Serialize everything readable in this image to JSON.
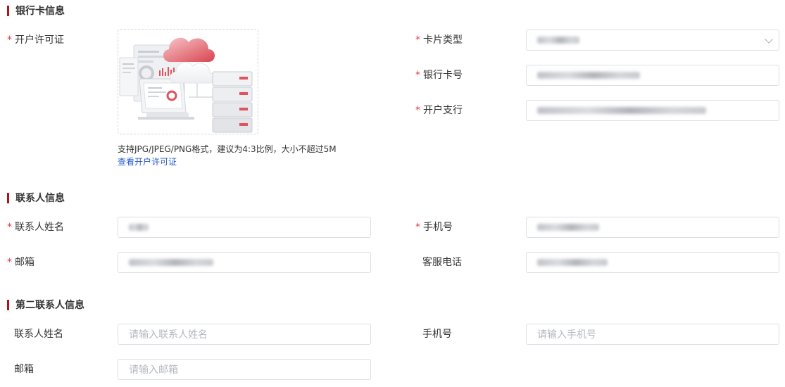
{
  "sections": {
    "bank": "银行卡信息",
    "contact": "联系人信息",
    "second_contact": "第二联系人信息"
  },
  "bank": {
    "license_label": "开户许可证",
    "upload_hint": "支持JPG/JPEG/PNG格式，建议为4:3比例，大小不超过5M",
    "view_license_link": "查看开户许可证",
    "card_type_label": "卡片类型",
    "card_number_label": "银行卡号",
    "branch_label": "开户支行"
  },
  "contact": {
    "name_label": "联系人姓名",
    "phone_label": "手机号",
    "email_label": "邮箱",
    "service_phone_label": "客服电话"
  },
  "second_contact": {
    "name_label": "联系人姓名",
    "name_placeholder": "请输入联系人姓名",
    "phone_label": "手机号",
    "phone_placeholder": "请输入手机号",
    "email_label": "邮箱",
    "email_placeholder": "请输入邮箱"
  },
  "required_mark": "*",
  "colors": {
    "accent": "#b3121b",
    "required": "#e0404b",
    "link": "#2b5bc8",
    "placeholder": "#b5b8bf",
    "border": "#dcdfe6"
  },
  "icons": {
    "upload_illustration": "cloud-server-illustration",
    "select_caret": "chevron-down-icon"
  }
}
